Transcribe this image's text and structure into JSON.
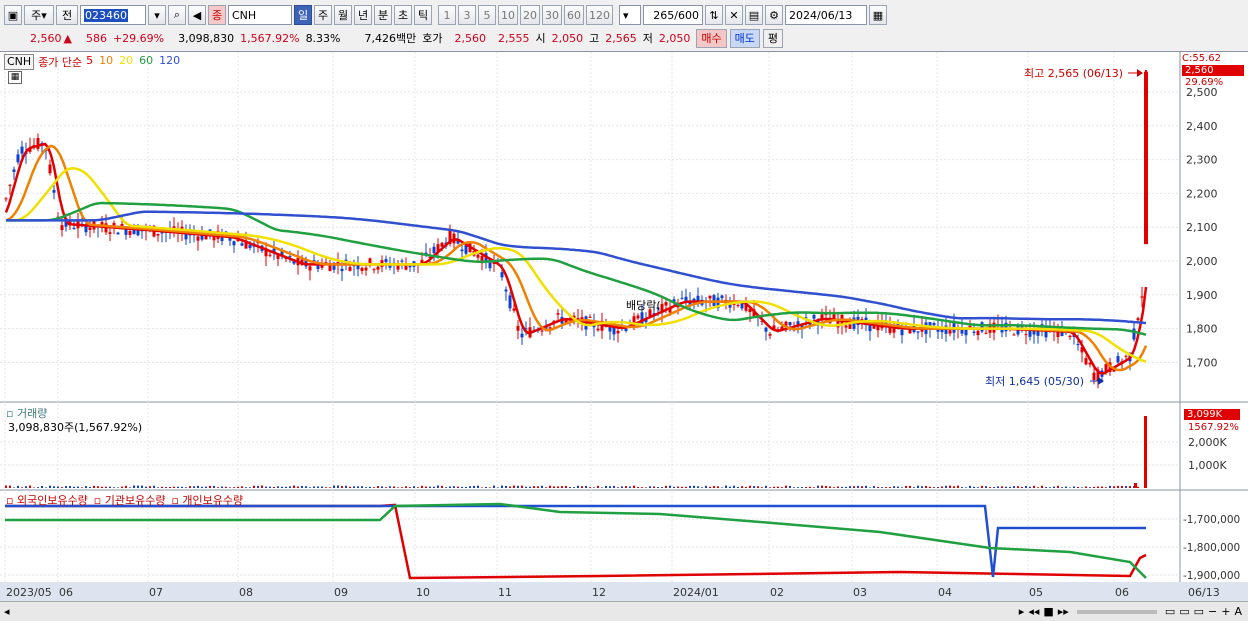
{
  "toolbar": {
    "type_label": "주",
    "prev_label": "전",
    "code_value": "023460",
    "jong_label": "종",
    "name_value": "CNH",
    "periods": [
      "일",
      "주",
      "월",
      "년",
      "분",
      "초",
      "틱"
    ],
    "active_period": "일",
    "nums": [
      "1",
      "3",
      "5",
      "10",
      "20",
      "30",
      "60",
      "120"
    ],
    "count": "265",
    "count_total": "/600",
    "date": "2024/06/13"
  },
  "quote": {
    "price": "2,560",
    "change": "586",
    "change_pct": "+29.69%",
    "volume": "3,098,830",
    "volume_pct": "1,567.92%",
    "turnover": "8.33%",
    "amount": "7,426백만",
    "bid_label": "호가",
    "bid1": "2,560",
    "bid2": "2,555",
    "open_label": "시",
    "open": "2,050",
    "high_label": "고",
    "high": "2,565",
    "low_label": "저",
    "low": "2,050",
    "buy": "매수",
    "sell": "매도",
    "flat": "평"
  },
  "legend": {
    "name": "CNH",
    "ma_label": "종가 단순",
    "ma": [
      {
        "label": "5",
        "color": "#e00000"
      },
      {
        "label": "10",
        "color": "#f08000"
      },
      {
        "label": "20",
        "color": "#f0e000"
      },
      {
        "label": "60",
        "color": "#20a040"
      },
      {
        "label": "120",
        "color": "#3050d0"
      }
    ]
  },
  "annotations": {
    "high": "최고 2,565 (06/13)",
    "low": "최저 1,645 (05/30)",
    "dividend": "배당락("
  },
  "price_axis": {
    "ticks": [
      "2,500",
      "2,400",
      "2,300",
      "2,200",
      "2,100",
      "2,000",
      "1,900",
      "1,800",
      "1,700"
    ],
    "top_label": "C:55.62",
    "last": "2,560",
    "last_pct": "29.69%"
  },
  "volume_panel": {
    "title": "거래량",
    "value": "3,098,830주(1,567.92%)",
    "ticks": [
      "2,000K",
      "1,000K"
    ],
    "last": "3,099K",
    "last_pct": "1567.92%"
  },
  "holdings_panel": {
    "legend": [
      "외국인보유수량",
      "기관보유수량",
      "개인보유수량"
    ],
    "ticks": [
      "-1,700,000",
      "-1,800,000",
      "-1,900,000"
    ]
  },
  "x_axis": {
    "labels": [
      "2023/05",
      "06",
      "07",
      "08",
      "09",
      "10",
      "11",
      "12",
      "2024/01",
      "02",
      "03",
      "04",
      "05",
      "06"
    ],
    "end_label": "06/13"
  },
  "chart_data": {
    "type": "line",
    "title": "",
    "series": [
      {
        "name": "5",
        "color": "#e00000"
      },
      {
        "name": "10",
        "color": "#f08000"
      },
      {
        "name": "20",
        "color": "#f0e000"
      },
      {
        "name": "60",
        "color": "#20a040"
      },
      {
        "name": "120",
        "color": "#3050d0"
      }
    ],
    "ylim": [
      1645,
      2565
    ],
    "last_close": 2560,
    "high": 2565,
    "low": 1645
  }
}
